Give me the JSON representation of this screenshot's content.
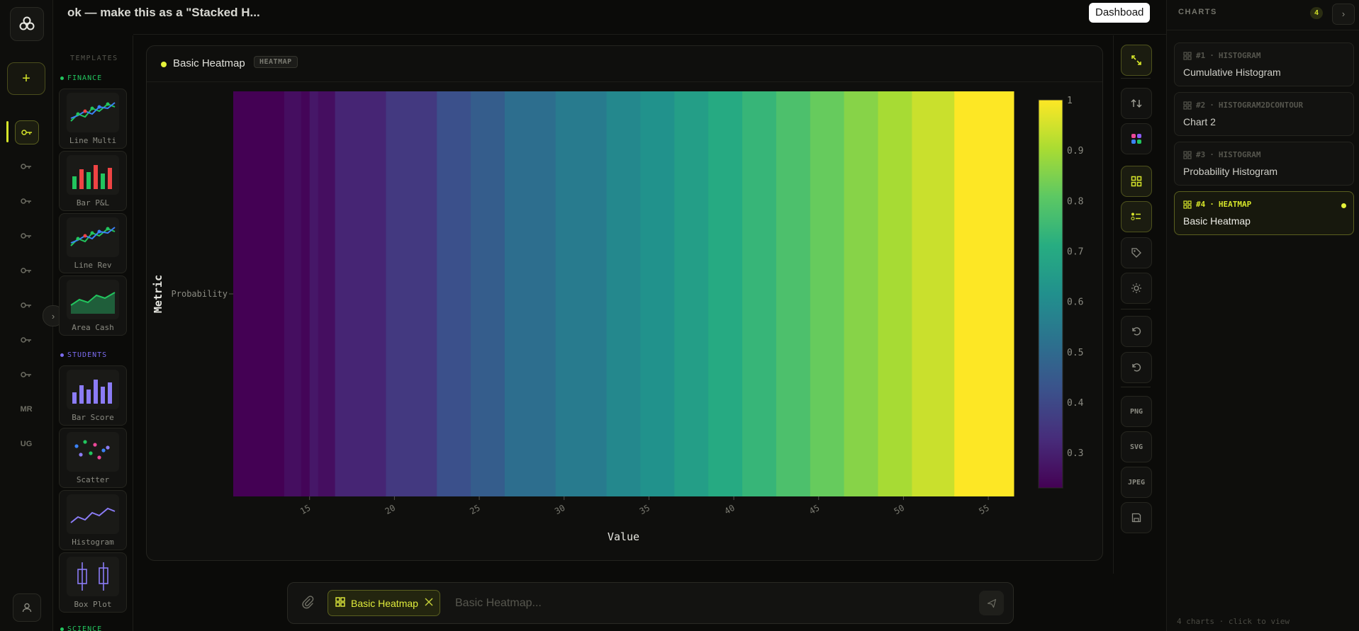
{
  "header": {
    "chat_title": "ok — make this as a \"Stacked H...",
    "dashboard_label": "Dashboad"
  },
  "rail": {
    "items": [
      "key",
      "key",
      "key",
      "key",
      "key",
      "key",
      "key",
      "key",
      "MR",
      "UG"
    ]
  },
  "templates": {
    "title": "TEMPLATES",
    "sections": [
      {
        "name": "FINANCE",
        "color": "#22c55e",
        "items": [
          "Line Multi",
          "Bar P&L",
          "Line Rev",
          "Area Cash"
        ]
      },
      {
        "name": "STUDENTS",
        "color": "#7c6cf0",
        "items": [
          "Bar Score",
          "Scatter",
          "Histogram",
          "Box Plot"
        ]
      },
      {
        "name": "SCIENCE",
        "color": "#22c55e",
        "items": []
      }
    ]
  },
  "panel": {
    "title": "Basic Heatmap",
    "badge": "HEATMAP"
  },
  "chart_data": {
    "type": "heatmap",
    "title": "",
    "xlabel": "Value",
    "ylabel": "Metric",
    "y_categories": [
      "Probability"
    ],
    "x_ticks": [
      15,
      20,
      25,
      30,
      35,
      40,
      45,
      50,
      55
    ],
    "xlim": [
      10.5,
      56.5
    ],
    "colorscale": "Viridis",
    "colorbar": {
      "min": 0.23,
      "max": 1,
      "ticks": [
        0.3,
        0.4,
        0.5,
        0.6,
        0.7,
        0.8,
        0.9,
        1
      ]
    },
    "cells": [
      {
        "x0": 10.5,
        "x1": 13.5,
        "value": 0.23
      },
      {
        "x0": 13.5,
        "x1": 14.5,
        "value": 0.26
      },
      {
        "x0": 14.5,
        "x1": 15.0,
        "value": 0.24
      },
      {
        "x0": 15.0,
        "x1": 15.5,
        "value": 0.28
      },
      {
        "x0": 15.5,
        "x1": 16.5,
        "value": 0.26
      },
      {
        "x0": 16.5,
        "x1": 19.5,
        "value": 0.31
      },
      {
        "x0": 19.5,
        "x1": 22.5,
        "value": 0.36
      },
      {
        "x0": 22.5,
        "x1": 24.5,
        "value": 0.42
      },
      {
        "x0": 24.5,
        "x1": 26.5,
        "value": 0.46
      },
      {
        "x0": 26.5,
        "x1": 29.5,
        "value": 0.51
      },
      {
        "x0": 29.5,
        "x1": 32.5,
        "value": 0.55
      },
      {
        "x0": 32.5,
        "x1": 34.5,
        "value": 0.59
      },
      {
        "x0": 34.5,
        "x1": 36.5,
        "value": 0.62
      },
      {
        "x0": 36.5,
        "x1": 38.5,
        "value": 0.66
      },
      {
        "x0": 38.5,
        "x1": 40.5,
        "value": 0.7
      },
      {
        "x0": 40.5,
        "x1": 42.5,
        "value": 0.74
      },
      {
        "x0": 42.5,
        "x1": 44.5,
        "value": 0.78
      },
      {
        "x0": 44.5,
        "x1": 46.5,
        "value": 0.82
      },
      {
        "x0": 46.5,
        "x1": 48.5,
        "value": 0.86
      },
      {
        "x0": 48.5,
        "x1": 50.5,
        "value": 0.9
      },
      {
        "x0": 50.5,
        "x1": 53.0,
        "value": 0.94
      },
      {
        "x0": 53.0,
        "x1": 56.5,
        "value": 1.0
      }
    ]
  },
  "toolbar": {
    "buttons": [
      "expand-icon",
      "sort-icon",
      "palette-icon",
      "grid-icon",
      "list-icon",
      "tag-icon",
      "theme-icon",
      "undo-icon",
      "redo-icon",
      "PNG",
      "SVG",
      "JPEG",
      "save-icon"
    ]
  },
  "sidebar": {
    "title": "CHARTS",
    "count": "4",
    "next": "›",
    "items": [
      {
        "num": "#1",
        "type": "HISTOGRAM",
        "name": "Cumulative Histogram"
      },
      {
        "num": "#2",
        "type": "HISTOGRAM2DCONTOUR",
        "name": "Chart 2"
      },
      {
        "num": "#3",
        "type": "HISTOGRAM",
        "name": "Probability Histogram"
      },
      {
        "num": "#4",
        "type": "HEATMAP",
        "name": "Basic Heatmap"
      }
    ],
    "footer": "4 charts · click to view"
  },
  "composer": {
    "chip_label": "Basic Heatmap",
    "placeholder": "Basic Heatmap..."
  },
  "colors": {
    "accent": "#d6e52a",
    "background": "#0b0b09"
  }
}
